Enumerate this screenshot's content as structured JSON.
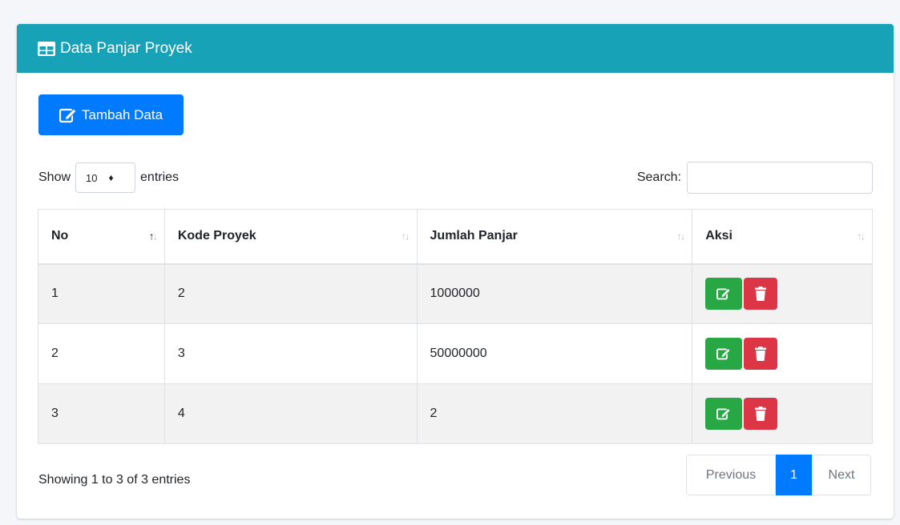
{
  "card": {
    "title": "Data Panjar Proyek",
    "header_color": "#17a2b8",
    "header_icon": "table-icon"
  },
  "toolbar": {
    "add_label": "Tambah Data",
    "add_icon": "edit-icon",
    "add_color": "#007bff"
  },
  "length": {
    "show_label": "Show",
    "selected": "10",
    "entries_label": "entries"
  },
  "search": {
    "label": "Search:",
    "value": "",
    "placeholder": ""
  },
  "table": {
    "columns": [
      "No",
      "Kode Proyek",
      "Jumlah Panjar",
      "Aksi"
    ],
    "sorted_column": "No",
    "rows": [
      {
        "no": "1",
        "kode": "2",
        "jumlah": "1000000"
      },
      {
        "no": "2",
        "kode": "3",
        "jumlah": "50000000"
      },
      {
        "no": "3",
        "kode": "4",
        "jumlah": "2"
      }
    ],
    "edit_icon": "edit-icon",
    "delete_icon": "trash-icon",
    "edit_color": "#28a745",
    "delete_color": "#dc3545"
  },
  "footer": {
    "info": "Showing 1 to 3 of 3 entries",
    "previous_label": "Previous",
    "current_page": "1",
    "next_label": "Next"
  }
}
